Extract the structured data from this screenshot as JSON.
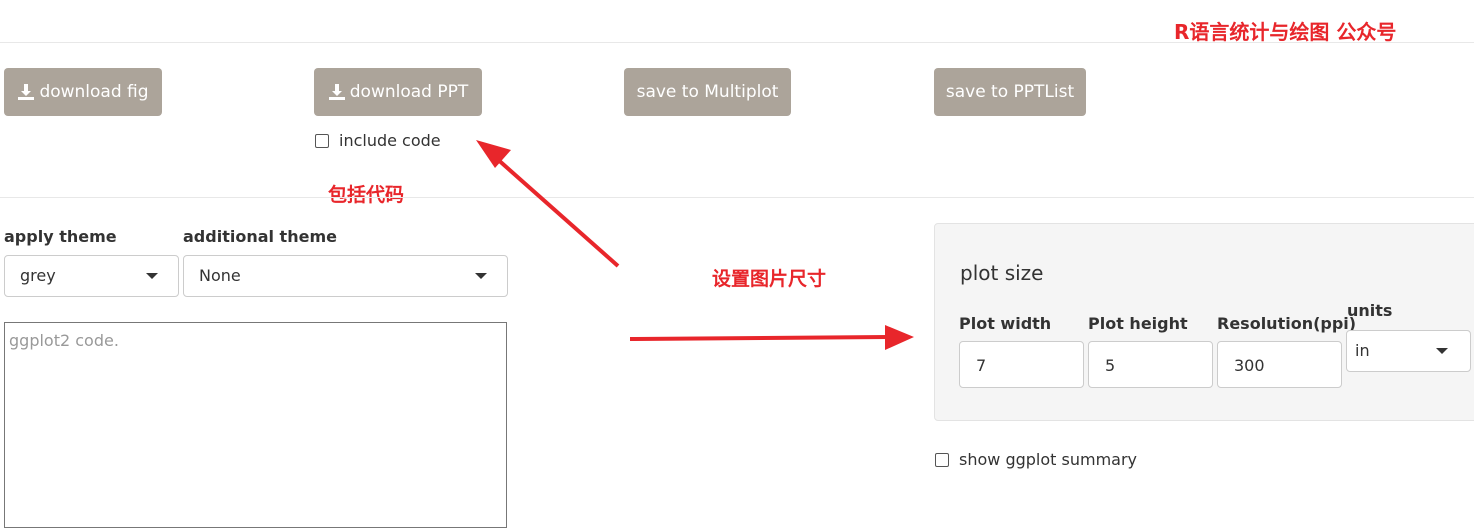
{
  "header": {
    "watermark": "R语言统计与绘图 公众号"
  },
  "toolbar": {
    "download_fig": "download fig",
    "download_ppt": "download PPT",
    "save_multiplot": "save to Multiplot",
    "save_pptlist": "save to PPTList",
    "include_code": "include code",
    "include_code_checked": false
  },
  "theme": {
    "apply_label": "apply theme",
    "apply_value": "grey",
    "additional_label": "additional theme",
    "additional_value": "None"
  },
  "code": {
    "placeholder": "ggplot2 code."
  },
  "plot_size": {
    "title": "plot size",
    "width_label": "Plot width",
    "width_value": "7",
    "height_label": "Plot height",
    "height_value": "5",
    "resolution_label": "Resolution(ppi)",
    "resolution_value": "300",
    "units_label": "units",
    "units_value": "in"
  },
  "summary": {
    "label": "show ggplot summary",
    "checked": false
  },
  "annotations": {
    "include_code_note": "包括代码",
    "plot_size_note": "设置图片尺寸"
  },
  "colors": {
    "button_bg": "#aca49a",
    "annotation_red": "#e8262b",
    "panel_bg": "#f5f5f5"
  }
}
